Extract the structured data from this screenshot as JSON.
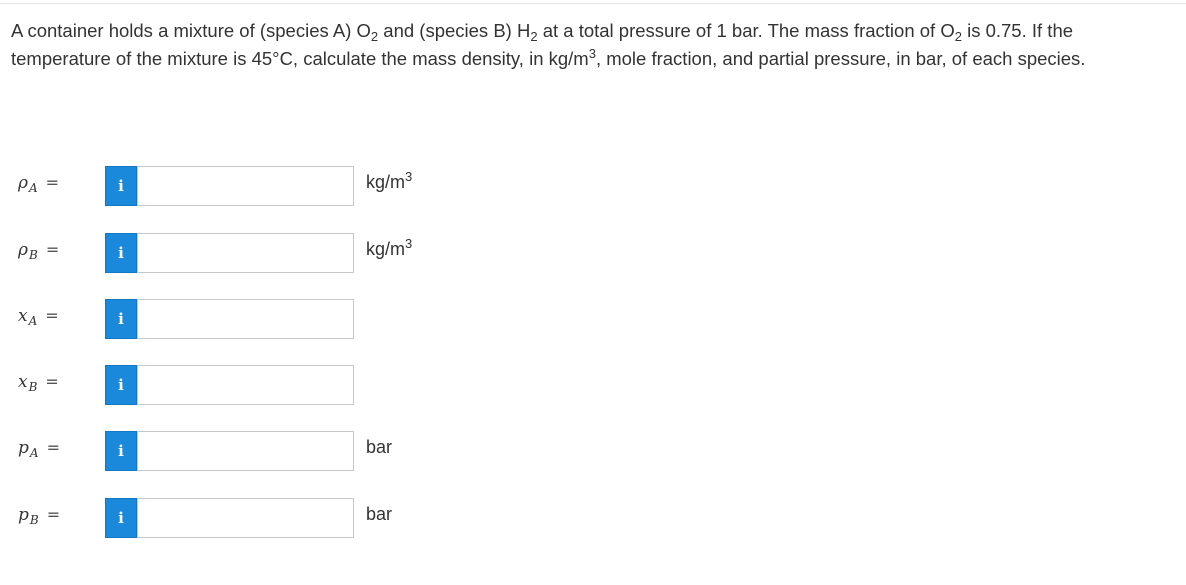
{
  "question": {
    "p1": "A container holds a mixture of (species A) O",
    "sub1": "2",
    "p2": " and (species B) H",
    "sub2": "2",
    "p3": " at a total pressure of 1 bar. The mass fraction of O",
    "sub3": "2",
    "p4": " is 0.75. If the temperature of the mixture is 45°C, calculate the mass density, in kg/m",
    "sup1": "3",
    "p5": ", mole fraction, and partial pressure, in bar, of each species."
  },
  "info_icon": {
    "glyph": "i",
    "icon": "info-icon",
    "color": "#1a88db"
  },
  "equals": "=",
  "rows": [
    {
      "symbol": "ρ",
      "sub": "A",
      "value": "",
      "unit_base": "kg/m",
      "unit_sup": "3"
    },
    {
      "symbol": "ρ",
      "sub": "B",
      "value": "",
      "unit_base": "kg/m",
      "unit_sup": "3"
    },
    {
      "symbol": "x",
      "sub": "A",
      "value": "",
      "unit_base": "",
      "unit_sup": ""
    },
    {
      "symbol": "x",
      "sub": "B",
      "value": "",
      "unit_base": "",
      "unit_sup": ""
    },
    {
      "symbol": "p",
      "sub": "A",
      "value": "",
      "unit_base": "bar",
      "unit_sup": ""
    },
    {
      "symbol": "p",
      "sub": "B",
      "value": "",
      "unit_base": "bar",
      "unit_sup": ""
    }
  ]
}
